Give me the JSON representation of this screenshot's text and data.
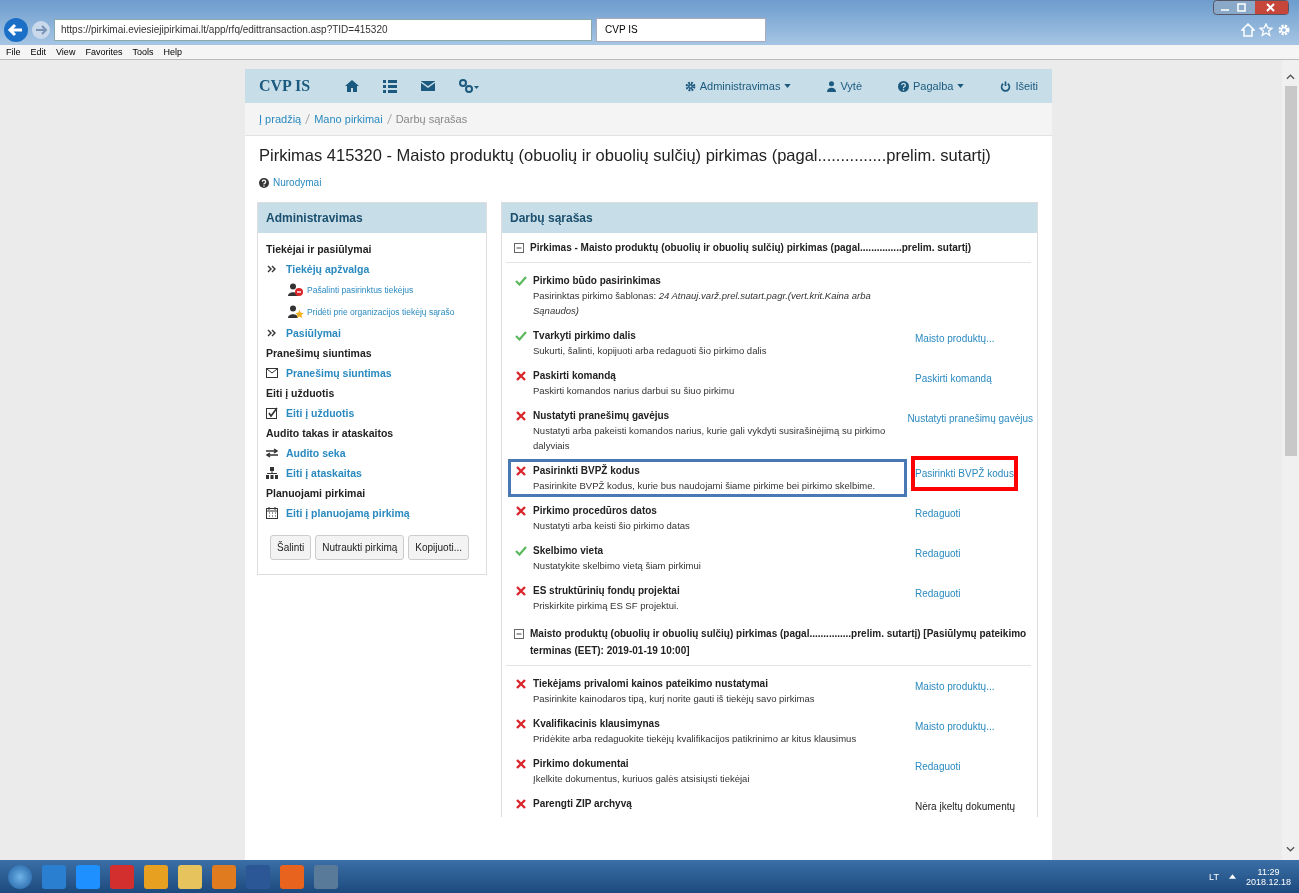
{
  "browser": {
    "url": "https://pirkimai.eviesiejipirkimai.lt/app/rfq/edittransaction.asp?TID=415320",
    "tab_title": "CVP IS",
    "menu": [
      "File",
      "Edit",
      "View",
      "Favorites",
      "Tools",
      "Help"
    ]
  },
  "navbar": {
    "brand": "CVP IS",
    "right": [
      {
        "label": "Administravimas",
        "dropdown": true
      },
      {
        "label": "Vytė",
        "dropdown": false
      },
      {
        "label": "Pagalba",
        "dropdown": true
      },
      {
        "label": "Išeiti",
        "dropdown": false
      }
    ]
  },
  "breadcrumb": [
    {
      "label": "Į pradžią",
      "link": true
    },
    {
      "label": "Mano pirkimai",
      "link": true
    },
    {
      "label": "Darbų sąrašas",
      "link": false
    }
  ],
  "title": "Pirkimas  415320 - Maisto produktų (obuolių ir obuolių sulčių) pirkimas (pagal...............prelim. sutartį)",
  "help_link": "Nurodymai",
  "sidebar": {
    "title": "Administravimas",
    "items": [
      {
        "kind": "heading",
        "label": "Tiekėjai ir pasiūlymai"
      },
      {
        "kind": "link",
        "label": "Tiekėjų apžvalga"
      },
      {
        "kind": "sublink",
        "label": "Pašalinti pasirinktus tiekėjus"
      },
      {
        "kind": "sublink",
        "label": "Pridėti prie organizacijos tiekėjų sąrašo"
      },
      {
        "kind": "link",
        "label": "Pasiūlymai"
      },
      {
        "kind": "heading",
        "label": "Pranešimų siuntimas"
      },
      {
        "kind": "link",
        "label": "Pranešimų siuntimas"
      },
      {
        "kind": "heading",
        "label": "Eiti į užduotis"
      },
      {
        "kind": "link",
        "label": "Eiti į užduotis"
      },
      {
        "kind": "heading",
        "label": "Audito takas ir ataskaitos"
      },
      {
        "kind": "link",
        "label": "Audito seka"
      },
      {
        "kind": "link",
        "label": "Eiti į ataskaitas"
      },
      {
        "kind": "heading",
        "label": "Planuojami pirkimai"
      },
      {
        "kind": "link",
        "label": "Eiti į planuojamą pirkimą"
      }
    ],
    "buttons": [
      "Šalinti",
      "Nutraukti pirkimą",
      "Kopijuoti..."
    ]
  },
  "tasks": {
    "title": "Darbų sąrašas",
    "groups": [
      {
        "title": "Pirkimas - Maisto produktų (obuolių ir obuolių sulčių) pirkimas (pagal...............prelim. sutartį)",
        "expanded": true,
        "items": [
          {
            "title": "Pirkimo būdo pasirinkimas",
            "done": true,
            "description": "Pasirinktas pirkimo šablonas: *24 Atnauj.varž.prel.sutart.pagr.(vert.krit.Kaina arba Sąnaudos)*"
          },
          {
            "title": "Tvarkyti pirkimo dalis",
            "done": true,
            "description": "Sukurti, šalinti, kopijuoti arba redaguoti šio pirkimo dalis",
            "action": {
              "kind": "link",
              "text": "Maisto produktų..."
            }
          },
          {
            "title": "Paskirti komandą",
            "done": false,
            "description": "Paskirti komandos narius darbui su šiuo pirkimu",
            "action": {
              "kind": "link",
              "text": "Paskirti komandą"
            }
          },
          {
            "title": "Nustatyti pranešimų gavėjus",
            "done": false,
            "description": "Nustatyti arba pakeisti komandos narius, kurie gali vykdyti susirašinėjimą su pirkimo dalyviais",
            "action": {
              "kind": "link",
              "text": "Nustatyti pranešimų gavėjus"
            }
          },
          {
            "title": "Pasirinkti BVPŽ kodus",
            "done": false,
            "description": "Pasirinkite BVPŽ kodus, kurie bus naudojami šiame pirkime bei pirkimo skelbime.",
            "framed": true,
            "action": {
              "kind": "link",
              "text": "Pasirinkti BVPŽ kodus",
              "framed": true
            }
          },
          {
            "title": "Pirkimo procedūros datos",
            "done": false,
            "description": "Nustatyti arba keisti šio pirkimo datas",
            "action": {
              "kind": "link",
              "text": "Redaguoti"
            }
          },
          {
            "title": "Skelbimo vieta",
            "done": true,
            "description": "Nustatykite skelbimo vietą šiam pirkimui",
            "action": {
              "kind": "link",
              "text": "Redaguoti"
            }
          },
          {
            "title": "ES struktūrinių fondų projektai",
            "done": false,
            "description": "Priskirkite pirkimą ES SF projektui.",
            "action": {
              "kind": "link",
              "text": "Redaguoti"
            }
          }
        ]
      },
      {
        "title": "Maisto produktų (obuolių ir obuolių sulčių) pirkimas (pagal...............prelim. sutartį) [Pasiūlymų pateikimo terminas (EET): 2019-01-19 10:00]",
        "expanded": true,
        "items": [
          {
            "title": "Tiekėjams privalomi kainos pateikimo nustatymai",
            "done": false,
            "description": "Pasirinkite kainodaros tipą, kurį norite gauti iš tiekėjų savo pirkimas",
            "action": {
              "kind": "link",
              "text": "Maisto produktų..."
            }
          },
          {
            "title": "Kvalifikacinis klausimynas",
            "done": false,
            "description": "Pridėkite arba redaguokite tiekėjų kvalifikacijos patikrinimo ar kitus klausimus",
            "action": {
              "kind": "link",
              "text": "Maisto produktų..."
            }
          },
          {
            "title": "Pirkimo dokumentai",
            "done": false,
            "description": "Įkelkite dokumentus, kuriuos galės atsisiųsti tiekėjai",
            "action": {
              "kind": "link",
              "text": "Redaguoti"
            }
          },
          {
            "title": "Parengti ZIP archyvą",
            "done": false,
            "action": {
              "kind": "text",
              "text": "Nėra įkeltų dokumentų"
            }
          }
        ]
      }
    ]
  },
  "taskbar": {
    "language": "LT",
    "time": "11:29",
    "date": "2018.12.18"
  }
}
